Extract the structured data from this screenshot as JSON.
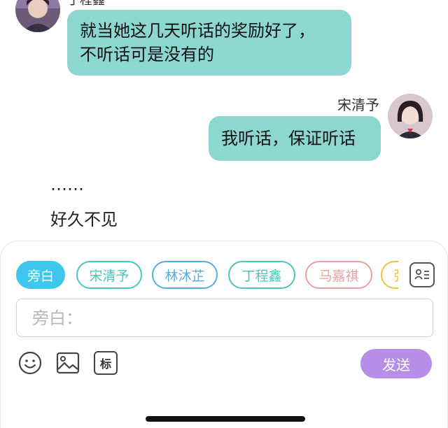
{
  "chat": {
    "messages": [
      {
        "sender": "丁程鑫",
        "side": "left",
        "text_line1": "就当她这几天听话的奖励好了，",
        "text_line2": "不听话可是没有的"
      },
      {
        "sender": "宋清予",
        "side": "right",
        "text": "我听话，保证听话"
      }
    ],
    "narrations": [
      "……",
      "好久不见"
    ]
  },
  "composer": {
    "roles": [
      {
        "label": "旁白",
        "color": "#3ec6ee",
        "active": true
      },
      {
        "label": "宋清予",
        "color": "#49c7b8",
        "active": false
      },
      {
        "label": "林沐芷",
        "color": "#55aee0",
        "active": false
      },
      {
        "label": "丁程鑫",
        "color": "#49c7b8",
        "active": false
      },
      {
        "label": "马嘉祺",
        "color": "#ee9fa4",
        "active": false
      },
      {
        "label": "张",
        "color": "#f2c13a",
        "active": false
      }
    ],
    "input_placeholder": "旁白：",
    "send_label": "发送",
    "mark_label": "标",
    "accent": "#b88fe8"
  }
}
